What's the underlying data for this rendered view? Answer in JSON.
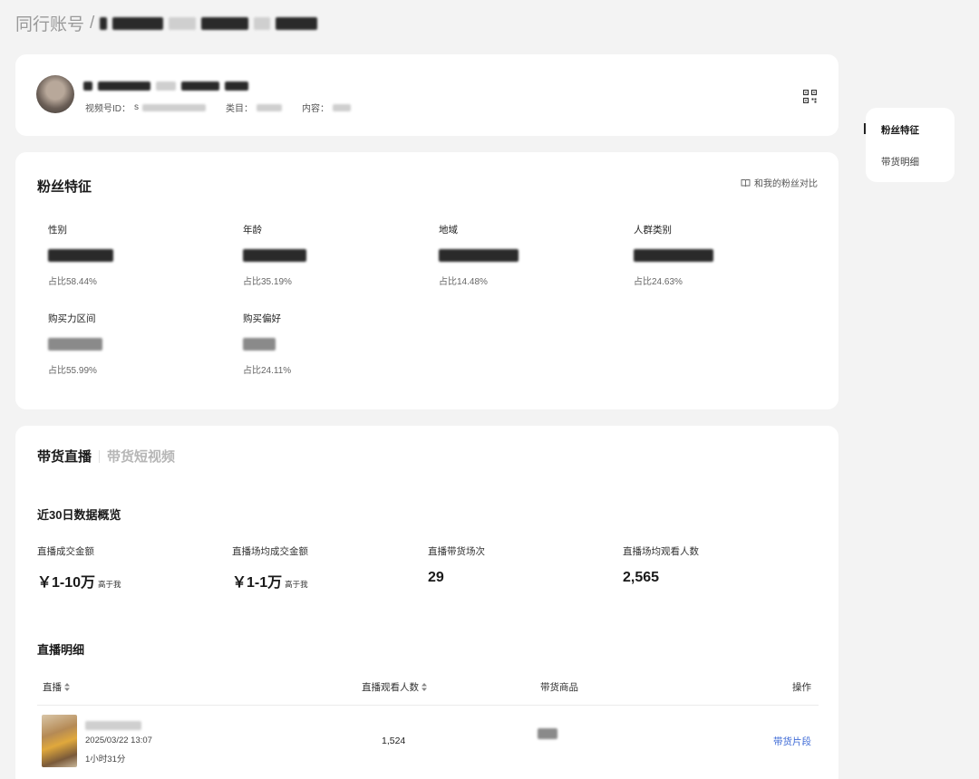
{
  "breadcrumb": {
    "root": "同行账号",
    "separator": "/"
  },
  "profile": {
    "id_label": "视频号ID：",
    "id_value": "s",
    "category_label": "类目：",
    "content_label": "内容："
  },
  "fans": {
    "title": "粉丝特征",
    "compare_label": "和我的粉丝对比",
    "traits": [
      {
        "label": "性别",
        "pct": "占比58.44%"
      },
      {
        "label": "年龄",
        "pct": "占比35.19%"
      },
      {
        "label": "地域",
        "pct": "占比14.48%"
      },
      {
        "label": "人群类别",
        "pct": "占比24.63%"
      },
      {
        "label": "购买力区间",
        "pct": "占比55.99%"
      },
      {
        "label": "购买偏好",
        "pct": "占比24.11%"
      }
    ]
  },
  "live": {
    "tabs": [
      "带货直播",
      "带货短视频"
    ],
    "overview_title": "近30日数据概览",
    "stats": [
      {
        "label": "直播成交金额",
        "value": "￥1-10万",
        "note": "高于我"
      },
      {
        "label": "直播场均成交金额",
        "value": "￥1-1万",
        "note": "高于我"
      },
      {
        "label": "直播带货场次",
        "value": "29",
        "note": ""
      },
      {
        "label": "直播场均观看人数",
        "value": "2,565",
        "note": ""
      }
    ],
    "detail_title": "直播明细",
    "columns": [
      "直播",
      "直播观看人数",
      "带货商品",
      "操作"
    ],
    "rows": [
      {
        "time": "2025/03/22 13:07",
        "duration": "1小时31分",
        "viewers": "1,524",
        "action": "带货片段"
      }
    ]
  },
  "sidenav": {
    "items": [
      "粉丝特征",
      "带货明细"
    ]
  }
}
